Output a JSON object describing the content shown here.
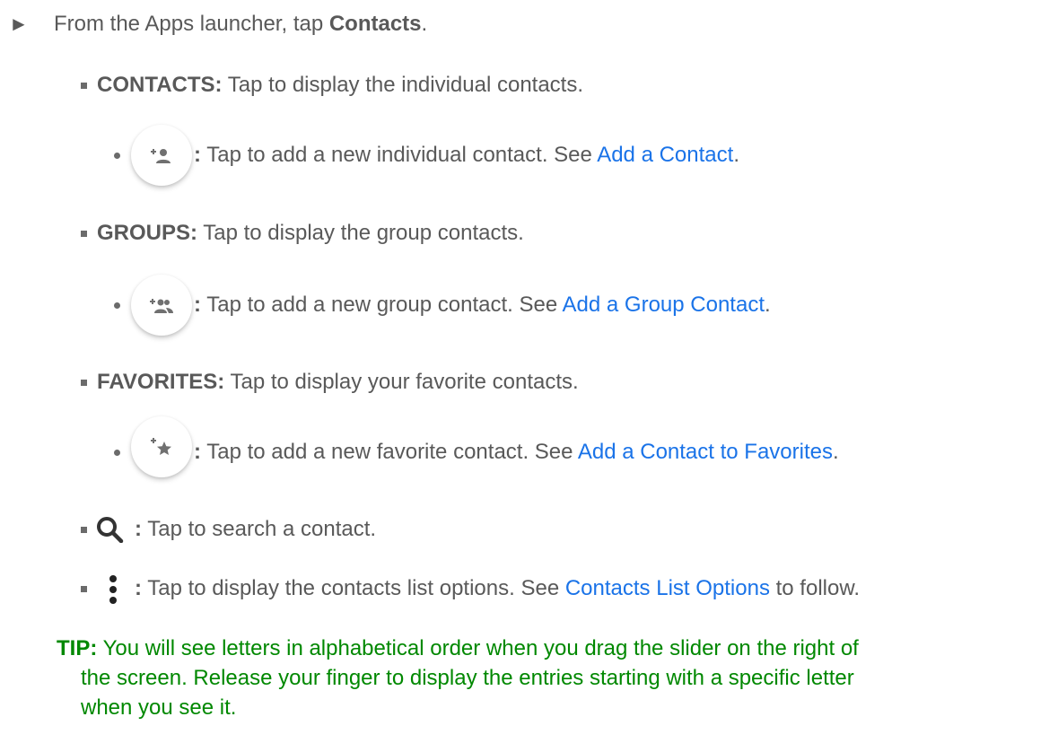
{
  "step": {
    "arrow": "►",
    "prefix": "From the Apps launcher, tap ",
    "bold": "Contacts",
    "suffix": "."
  },
  "items": {
    "contacts": {
      "label": "CONTACTS:",
      "text": " Tap to display the individual contacts.",
      "sub": {
        "icon": "add-person-icon",
        "colon": ":",
        "text": " Tap to add a new individual contact. See ",
        "link": "Add a Contact",
        "suffix": "."
      }
    },
    "groups": {
      "label": "GROUPS:",
      "text": " Tap to display the group contacts.",
      "sub": {
        "icon": "add-group-icon",
        "colon": ":",
        "text": " Tap to add a new group contact. See ",
        "link": "Add a Group Contact",
        "suffix": "."
      }
    },
    "favorites": {
      "label": "FAVORITES:",
      "text": " Tap to display your favorite contacts.",
      "sub": {
        "icon": "add-favorite-star-icon",
        "colon": ":",
        "text": " Tap to add a new favorite contact. See ",
        "link": "Add a Contact to Favorites",
        "suffix": "."
      }
    },
    "search": {
      "icon": "search-icon",
      "colon": ":",
      "text": " Tap to search a contact."
    },
    "menu": {
      "icon": "more-vert-icon",
      "colon": ":",
      "text": " Tap to display the contacts list options. See ",
      "link": "Contacts List Options",
      "suffix": " to follow."
    }
  },
  "tip": {
    "label": "TIP:",
    "line1": " You will see letters in alphabetical order when you drag the slider on the right of",
    "line2": "the screen. Release your finger to display the entries starting with a specific letter",
    "line3": "when you see it."
  },
  "colors": {
    "body_text": "#595959",
    "link": "#1a73e8",
    "tip": "#008800"
  }
}
